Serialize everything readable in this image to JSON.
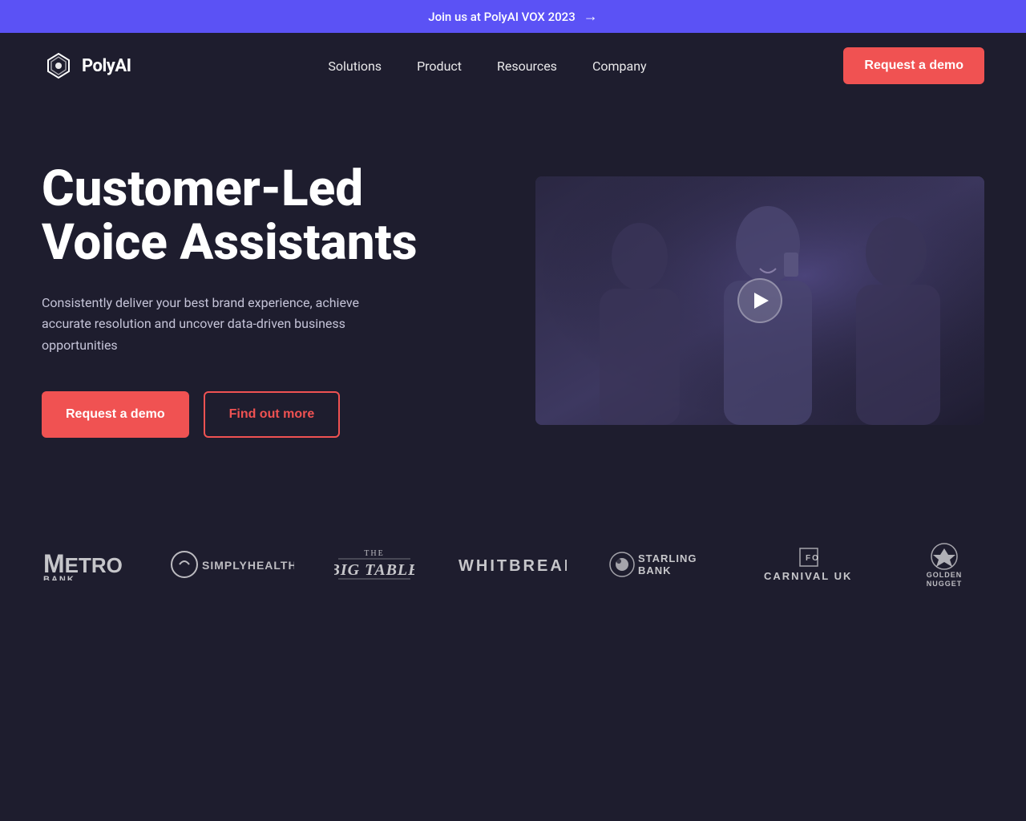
{
  "banner": {
    "text": "Join us at PolyAI VOX 2023",
    "bg_color": "#5b52f5"
  },
  "nav": {
    "logo_text": "PolyAI",
    "links": [
      {
        "label": "Solutions",
        "id": "solutions"
      },
      {
        "label": "Product",
        "id": "product"
      },
      {
        "label": "Resources",
        "id": "resources"
      },
      {
        "label": "Company",
        "id": "company"
      }
    ],
    "cta_label": "Request a demo"
  },
  "hero": {
    "title_line1": "Customer-Led",
    "title_line2": "Voice Assistants",
    "subtitle": "Consistently deliver your best brand experience, achieve accurate resolution and uncover data-driven business opportunities",
    "btn_primary": "Request a demo",
    "btn_outline": "Find out more"
  },
  "brands": [
    {
      "name": "Metro Bank",
      "id": "metro-bank"
    },
    {
      "name": "Simplyhealth",
      "id": "simplyhealth"
    },
    {
      "name": "The Big Table",
      "id": "big-table"
    },
    {
      "name": "WHITBREAD",
      "id": "whitbread"
    },
    {
      "name": "Starling Bank",
      "id": "starling-bank"
    },
    {
      "name": "CARNIVAL UK",
      "id": "carnival-uk"
    },
    {
      "name": "Golden Nugget",
      "id": "golden-nugget"
    }
  ],
  "colors": {
    "banner": "#5b52f5",
    "bg": "#1e1d2e",
    "primary": "#f05252",
    "text_muted": "#c5c4d8"
  }
}
